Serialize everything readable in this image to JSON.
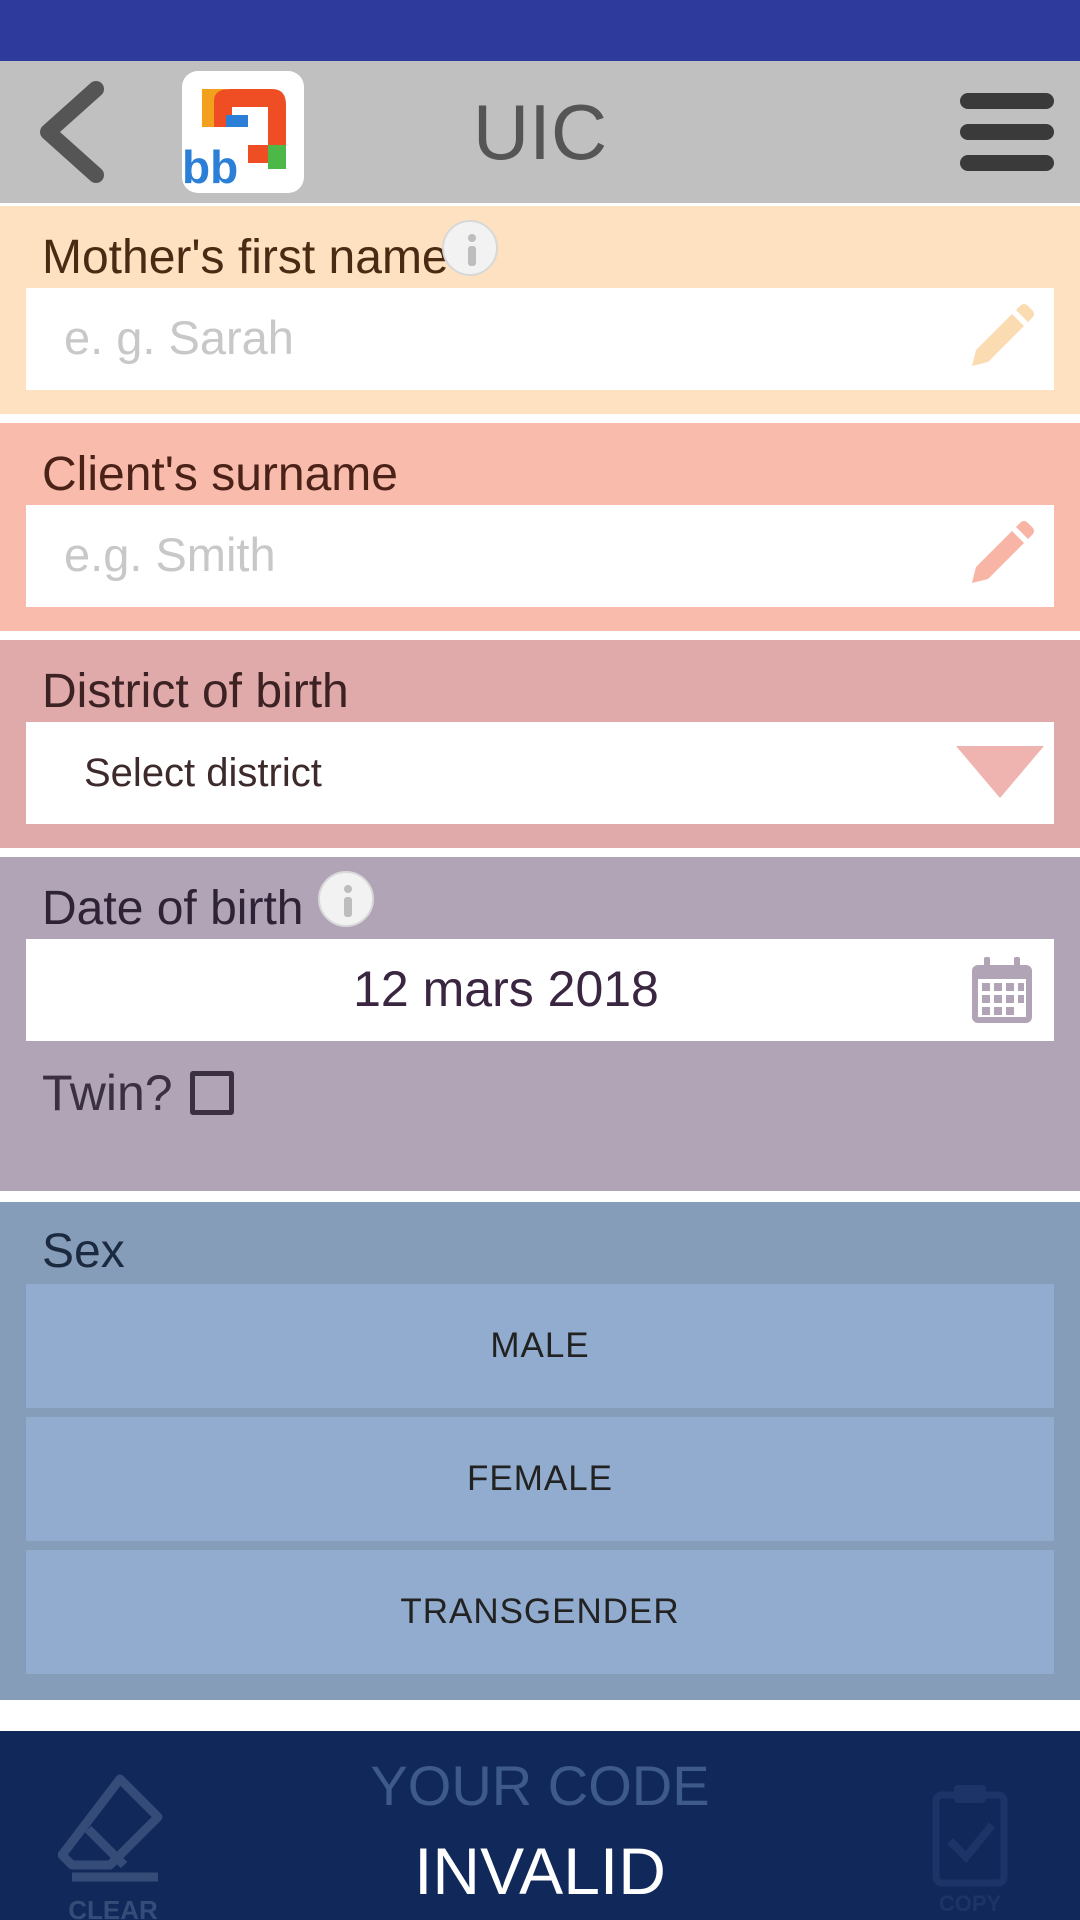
{
  "header": {
    "title": "UIC",
    "logo_text": "bb"
  },
  "mother": {
    "label": "Mother's first name",
    "placeholder": "e. g. Sarah"
  },
  "surname": {
    "label": "Client's surname",
    "placeholder": "e.g. Smith"
  },
  "district": {
    "label": "District of birth",
    "selected": "Select district"
  },
  "dob": {
    "label": "Date of birth",
    "value": "12 mars 2018",
    "twin_label": "Twin?"
  },
  "sex": {
    "label": "Sex",
    "options": [
      "MALE",
      "FEMALE",
      "TRANSGENDER"
    ]
  },
  "footer": {
    "clear_label": "CLEAR",
    "code_label": "YOUR CODE",
    "code_value": "INVALID",
    "copy_label": "COPY"
  },
  "colors": {
    "status_bar": "#2e3a9c",
    "app_bar": "#c0c0c0",
    "mother_bg": "#fde1c1",
    "surname_bg": "#f9bbac",
    "district_bg": "#e0a9aa",
    "dob_bg": "#b0a4b6",
    "sex_bg": "#869db9",
    "sex_button": "#91acce",
    "footer_bg": "#11295a"
  },
  "icons": [
    "back-arrow-icon",
    "app-logo",
    "hamburger-menu-icon",
    "info-icon",
    "pencil-icon",
    "dropdown-arrow-icon",
    "calendar-icon",
    "eraser-icon",
    "clipboard-icon"
  ]
}
